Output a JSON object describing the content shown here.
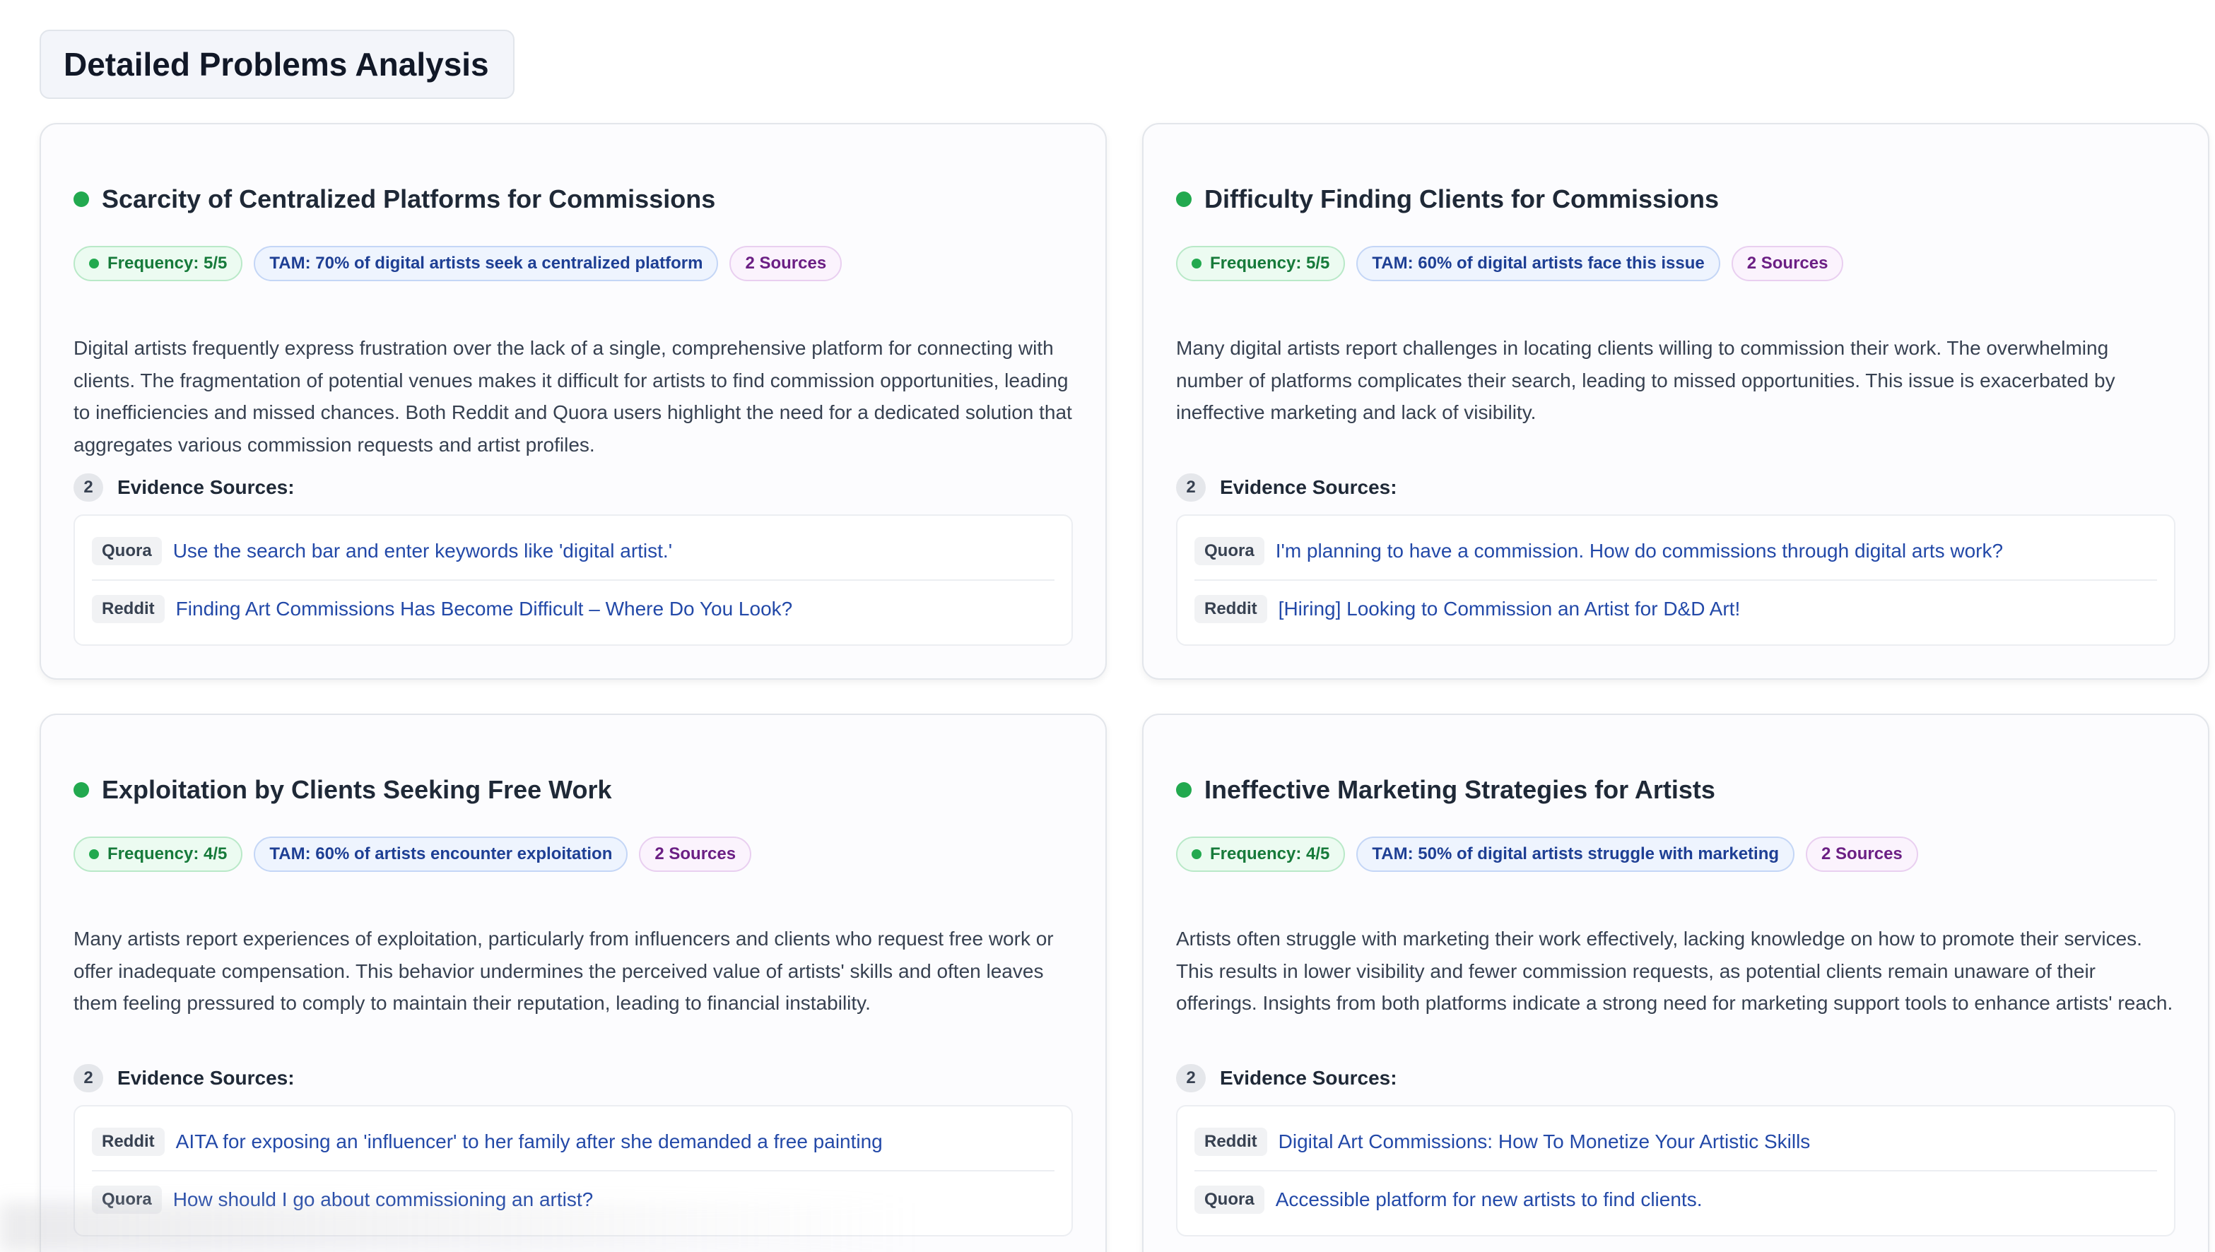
{
  "page": {
    "title": "Detailed Problems Analysis"
  },
  "colors": {
    "status_green": "#22a94f",
    "link_blue": "#2349a8",
    "freq_badge_text": "#167a3a",
    "tam_badge_text": "#1e3f94",
    "sources_badge_text": "#6b1f84"
  },
  "icons": {
    "status": "status-dot-icon",
    "frequency": "frequency-dot-icon"
  },
  "cards": [
    {
      "title": "Scarcity of Centralized Platforms for Commissions",
      "frequency": "Frequency: 5/5",
      "tam": "TAM: 70% of digital artists seek a centralized platform",
      "sources_count": "2 Sources",
      "description": "Digital artists frequently express frustration over the lack of a single, comprehensive platform for connecting with clients. The fragmentation of potential venues makes it difficult for artists to find commission opportunities, leading to inefficiencies and missed chances. Both Reddit and Quora users highlight the need for a dedicated solution that aggregates various commission requests and artist profiles.",
      "evidence_count": "2",
      "evidence_label": "Evidence Sources:",
      "sources": [
        {
          "platform": "Quora",
          "title": "Use the search bar and enter keywords like 'digital artist.'"
        },
        {
          "platform": "Reddit",
          "title": "Finding Art Commissions Has Become Difficult – Where Do You Look?"
        }
      ]
    },
    {
      "title": "Difficulty Finding Clients for Commissions",
      "frequency": "Frequency: 5/5",
      "tam": "TAM: 60% of digital artists face this issue",
      "sources_count": "2 Sources",
      "description": "Many digital artists report challenges in locating clients willing to commission their work. The overwhelming number of platforms complicates their search, leading to missed opportunities. This issue is exacerbated by ineffective marketing and lack of visibility.",
      "evidence_count": "2",
      "evidence_label": "Evidence Sources:",
      "sources": [
        {
          "platform": "Quora",
          "title": "I'm planning to have a commission. How do commissions through digital arts work?"
        },
        {
          "platform": "Reddit",
          "title": "[Hiring] Looking to Commission an Artist for D&D Art!"
        }
      ]
    },
    {
      "title": "Exploitation by Clients Seeking Free Work",
      "frequency": "Frequency: 4/5",
      "tam": "TAM: 60% of artists encounter exploitation",
      "sources_count": "2 Sources",
      "description": "Many artists report experiences of exploitation, particularly from influencers and clients who request free work or offer inadequate compensation. This behavior undermines the perceived value of artists' skills and often leaves them feeling pressured to comply to maintain their reputation, leading to financial instability.",
      "evidence_count": "2",
      "evidence_label": "Evidence Sources:",
      "sources": [
        {
          "platform": "Reddit",
          "title": "AITA for exposing an 'influencer' to her family after she demanded a free painting"
        },
        {
          "platform": "Quora",
          "title": "How should I go about commissioning an artist?"
        }
      ]
    },
    {
      "title": "Ineffective Marketing Strategies for Artists",
      "frequency": "Frequency: 4/5",
      "tam": "TAM: 50% of digital artists struggle with marketing",
      "sources_count": "2 Sources",
      "description": "Artists often struggle with marketing their work effectively, lacking knowledge on how to promote their services. This results in lower visibility and fewer commission requests, as potential clients remain unaware of their offerings. Insights from both platforms indicate a strong need for marketing support tools to enhance artists' reach.",
      "evidence_count": "2",
      "evidence_label": "Evidence Sources:",
      "sources": [
        {
          "platform": "Reddit",
          "title": "Digital Art Commissions: How To Monetize Your Artistic Skills"
        },
        {
          "platform": "Quora",
          "title": "Accessible platform for new artists to find clients."
        }
      ]
    }
  ]
}
